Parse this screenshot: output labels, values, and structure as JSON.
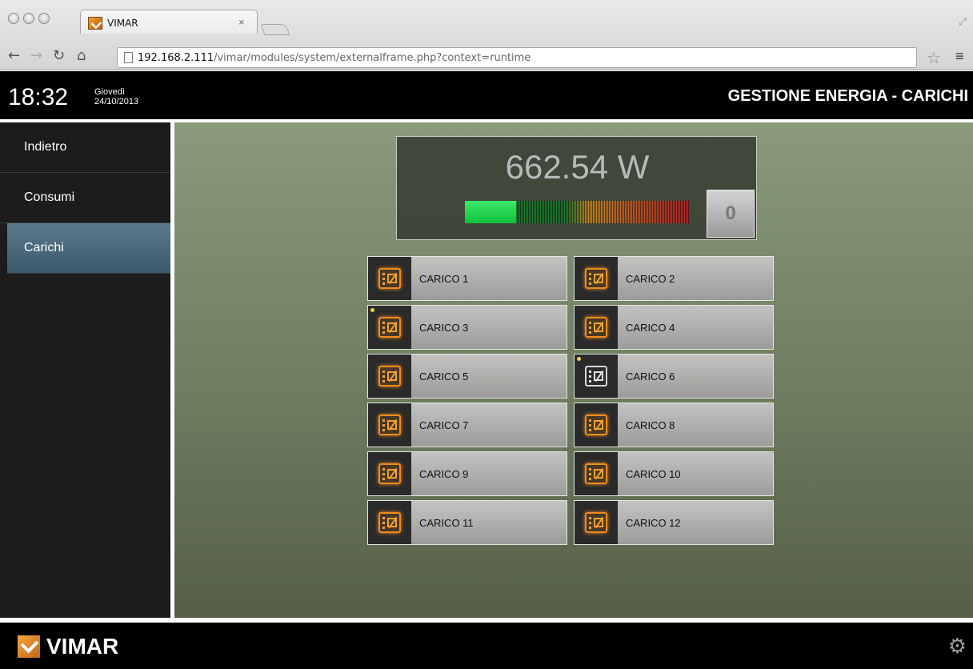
{
  "browser": {
    "tab_title": "VIMAR",
    "tab_close": "×",
    "url_host": "192.168.2.111",
    "url_path": "/vimar/modules/system/externalframe.php?context=runtime"
  },
  "header": {
    "time": "18:32",
    "day": "Giovedì",
    "date": "24/10/2013",
    "title": "GESTIONE ENERGIA - CARICHI"
  },
  "sidebar": {
    "items": [
      {
        "label": "Indietro",
        "active": false
      },
      {
        "label": "Consumi",
        "active": false
      },
      {
        "label": "Carichi",
        "active": true
      }
    ]
  },
  "power": {
    "value": "662.54 W",
    "meter_fraction": 0.23,
    "reset_label": "0"
  },
  "loads": [
    {
      "label": "CARICO 1",
      "on": true,
      "led": false
    },
    {
      "label": "CARICO 2",
      "on": true,
      "led": false
    },
    {
      "label": "CARICO 3",
      "on": true,
      "led": true
    },
    {
      "label": "CARICO 4",
      "on": true,
      "led": false
    },
    {
      "label": "CARICO 5",
      "on": true,
      "led": false
    },
    {
      "label": "CARICO 6",
      "on": false,
      "led": true
    },
    {
      "label": "CARICO 7",
      "on": true,
      "led": false
    },
    {
      "label": "CARICO 8",
      "on": true,
      "led": false
    },
    {
      "label": "CARICO 9",
      "on": true,
      "led": false
    },
    {
      "label": "CARICO 10",
      "on": true,
      "led": false
    },
    {
      "label": "CARICO 11",
      "on": true,
      "led": false
    },
    {
      "label": "CARICO 12",
      "on": true,
      "led": false
    }
  ],
  "footer": {
    "brand": "VIMAR"
  },
  "icons": {
    "load_icon": "load-switch-icon",
    "settings": "gear-icon",
    "brand_logo": "vimar-logo"
  },
  "colors": {
    "active_nav": "#4a6a7b",
    "meter_green": "#11c13d",
    "load_icon_on": "#f08a1c"
  }
}
